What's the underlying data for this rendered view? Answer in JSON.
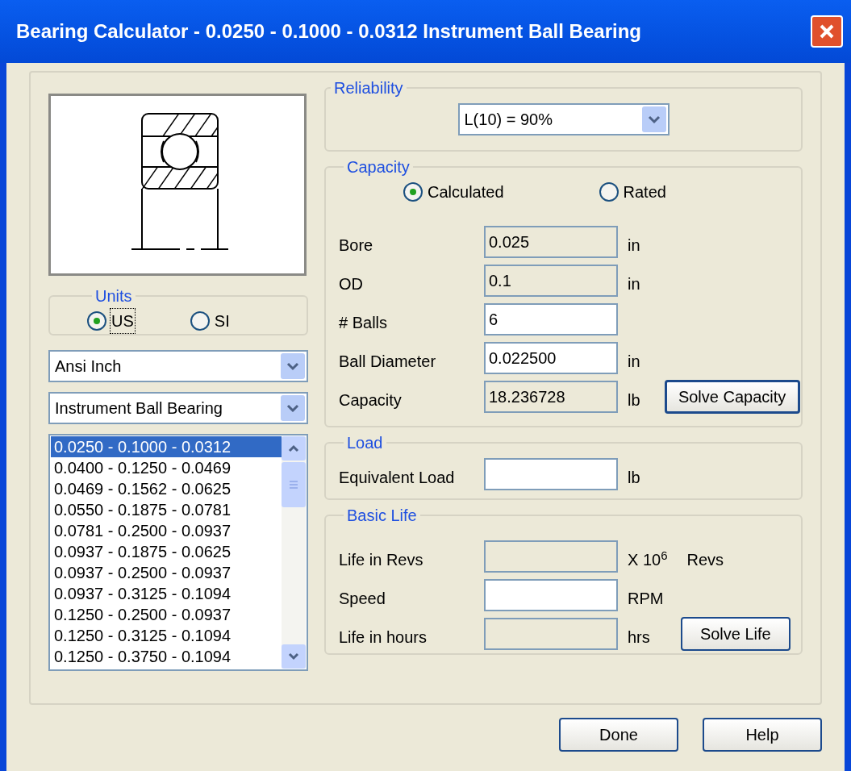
{
  "window": {
    "title": "Bearing Calculator - 0.0250 - 0.1000 - 0.0312 Instrument Ball Bearing"
  },
  "units": {
    "label": "Units",
    "options": [
      {
        "label": "US",
        "selected": true,
        "focused": true
      },
      {
        "label": "SI",
        "selected": false,
        "focused": false
      }
    ]
  },
  "standard_dropdown": {
    "value": "Ansi Inch"
  },
  "type_dropdown": {
    "value": "Instrument Ball Bearing"
  },
  "size_list": {
    "items": [
      {
        "label": "0.0250 - 0.1000 - 0.0312",
        "selected": true
      },
      {
        "label": "0.0400 - 0.1250 - 0.0469",
        "selected": false
      },
      {
        "label": "0.0469 - 0.1562 - 0.0625",
        "selected": false
      },
      {
        "label": "0.0550 - 0.1875 - 0.0781",
        "selected": false
      },
      {
        "label": "0.0781 - 0.2500 - 0.0937",
        "selected": false
      },
      {
        "label": "0.0937 - 0.1875 - 0.0625",
        "selected": false
      },
      {
        "label": "0.0937 - 0.2500 - 0.0937",
        "selected": false
      },
      {
        "label": "0.0937 - 0.3125 - 0.1094",
        "selected": false
      },
      {
        "label": "0.1250 - 0.2500 - 0.0937",
        "selected": false
      },
      {
        "label": "0.1250 - 0.3125 - 0.1094",
        "selected": false
      },
      {
        "label": "0.1250 - 0.3750 - 0.1094",
        "selected": false
      }
    ]
  },
  "reliability": {
    "label": "Reliability",
    "dropdown": {
      "value": "L(10) = 90%"
    }
  },
  "capacity": {
    "label": "Capacity",
    "modes": [
      {
        "label": "Calculated",
        "selected": true
      },
      {
        "label": "Rated",
        "selected": false
      }
    ],
    "fields": [
      {
        "label": "Bore",
        "value": "0.025",
        "unit": "in",
        "kind": "readonly"
      },
      {
        "label": "OD",
        "value": "0.1",
        "unit": "in",
        "kind": "readonly"
      },
      {
        "label": "# Balls",
        "value": "6",
        "kind": "input"
      },
      {
        "label": "Ball Diameter",
        "value": "0.022500",
        "unit": "in",
        "kind": "input"
      },
      {
        "label": "Capacity",
        "value": "18.236728",
        "unit": "lb",
        "kind": "readonly"
      }
    ],
    "button": "Solve Capacity"
  },
  "load": {
    "label": "Load",
    "fields": [
      {
        "label": "Equivalent Load",
        "unit": "lb",
        "kind": "input"
      }
    ]
  },
  "basic_life": {
    "label": "Basic Life",
    "fields": [
      {
        "label": "Life in Revs",
        "unit": "X 10$^{6}$",
        "unit_2": "Revs",
        "kind": "readonly"
      },
      {
        "label": "Speed",
        "unit": "RPM",
        "kind": "input"
      },
      {
        "label": "Life in hours",
        "unit": "hrs",
        "kind": "readonly"
      }
    ],
    "button": "Solve Life"
  },
  "buttons": [
    "Done",
    "Help"
  ]
}
